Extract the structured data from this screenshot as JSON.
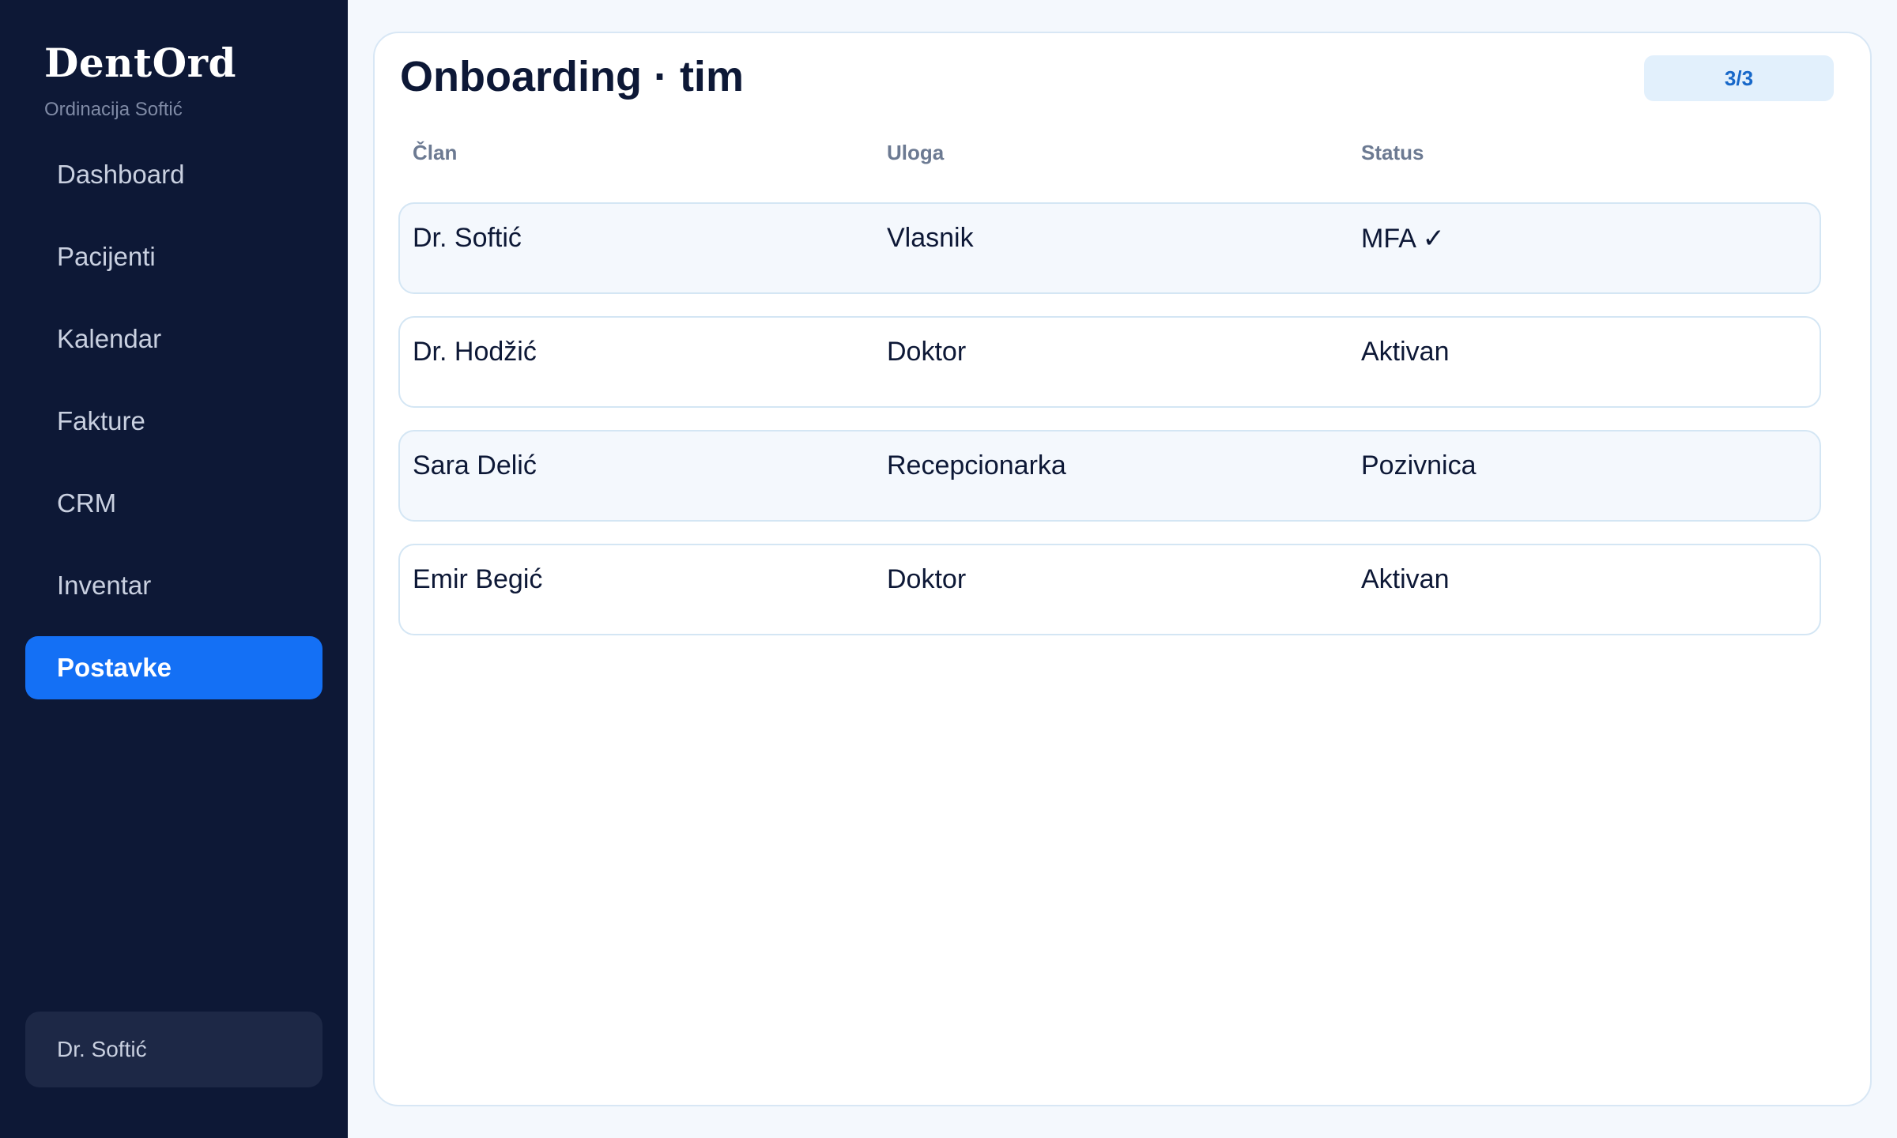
{
  "app": {
    "name": "DentOrd",
    "clinic": "Ordinacija Softić"
  },
  "sidebar": {
    "items": [
      {
        "label": "Dashboard"
      },
      {
        "label": "Pacijenti"
      },
      {
        "label": "Kalendar"
      },
      {
        "label": "Fakture"
      },
      {
        "label": "CRM"
      },
      {
        "label": "Inventar"
      },
      {
        "label": "Postavke",
        "active": true
      }
    ],
    "user": "Dr. Softić"
  },
  "main": {
    "title": "Onboarding · tim",
    "step_badge": "3/3",
    "columns": [
      "Član",
      "Uloga",
      "Status"
    ],
    "rows": [
      {
        "member": "Dr. Softić",
        "role": "Vlasnik",
        "status": "MFA ✓"
      },
      {
        "member": "Dr. Hodžić",
        "role": "Doktor",
        "status": "Aktivan"
      },
      {
        "member": "Sara Delić",
        "role": "Recepcionarka",
        "status": "Pozivnica"
      },
      {
        "member": "Emir Begić",
        "role": "Doktor",
        "status": "Aktivan"
      }
    ]
  },
  "colors": {
    "sidebar_bg": "#0d1836",
    "accent": "#1470f5",
    "page_bg": "#f4f8fd",
    "badge_bg": "#e2f0fc",
    "badge_text": "#1768c9"
  }
}
